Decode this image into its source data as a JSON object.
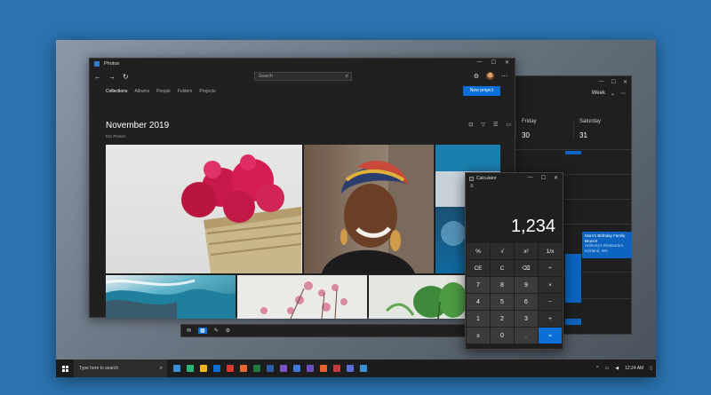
{
  "photos": {
    "window_title": "Photos",
    "search_placeholder": "Search",
    "tabs": [
      "Collections",
      "Albums",
      "People",
      "Folders",
      "Projects"
    ],
    "new_project_label": "New project",
    "heading": "November 2019",
    "count": "511 Photos"
  },
  "calendar": {
    "view_label": "Week",
    "days": [
      {
        "name": "Friday",
        "num": "30"
      },
      {
        "name": "Saturday",
        "num": "31"
      }
    ],
    "event": {
      "title": "Mom's Birthday Family Brunch",
      "location": "Anthony's Restaurant",
      "city": "Kirkland, WA"
    }
  },
  "calculator": {
    "title": "Calculator",
    "display": "1,234",
    "keys": [
      "%",
      "√",
      "x²",
      "1/x",
      "CE",
      "C",
      "⌫",
      "÷",
      "7",
      "8",
      "9",
      "×",
      "4",
      "5",
      "6",
      "−",
      "1",
      "2",
      "3",
      "+",
      "±",
      "0",
      ".",
      "="
    ]
  },
  "taskbar": {
    "search_placeholder": "Type here to search",
    "clock": "12:24 AM",
    "icon_colors": [
      "#3b8fd8",
      "#2bb673",
      "#f2b51d",
      "#0a6fd6",
      "#d73b2f",
      "#e8692c",
      "#1f7a3d",
      "#2f5ea8",
      "#7f4fc5",
      "#3d7bd6",
      "#6c4fbf",
      "#e8602a",
      "#c43a3a",
      "#5a6fd8",
      "#3b8fd8"
    ]
  },
  "colors": {
    "accent": "#0a6fd6",
    "background": "#2b73b0"
  }
}
